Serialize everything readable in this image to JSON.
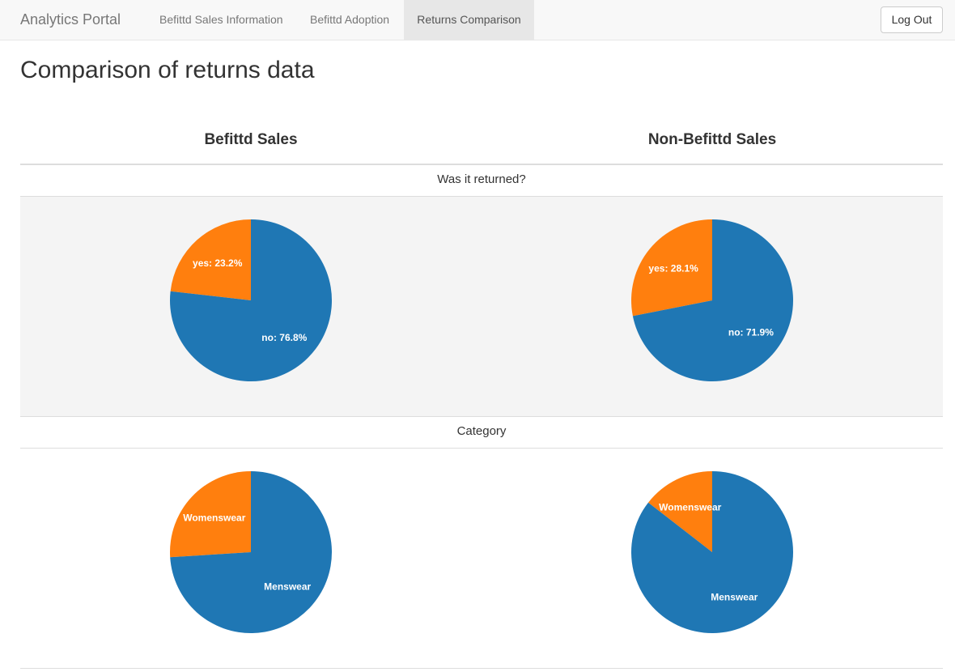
{
  "navbar": {
    "brand": "Analytics Portal",
    "items": [
      {
        "label": "Befittd Sales Information",
        "active": false
      },
      {
        "label": "Befittd Adoption",
        "active": false
      },
      {
        "label": "Returns Comparison",
        "active": true
      }
    ],
    "logout_label": "Log Out"
  },
  "page": {
    "title": "Comparison of returns data",
    "columns": [
      "Befittd Sales",
      "Non-Befittd Sales"
    ]
  },
  "sections": [
    {
      "label": "Was it returned?"
    },
    {
      "label": "Category"
    }
  ],
  "colors": {
    "blue": "#1f77b4",
    "orange": "#ff7f0e"
  },
  "chart_data": [
    {
      "type": "pie",
      "group": "Befittd Sales",
      "section": "Was it returned?",
      "slices": [
        {
          "name": "yes",
          "label": "yes: 23.2%",
          "value": 23.2,
          "color": "#ff7f0e"
        },
        {
          "name": "no",
          "label": "no: 76.8%",
          "value": 76.8,
          "color": "#1f77b4"
        }
      ]
    },
    {
      "type": "pie",
      "group": "Non-Befittd Sales",
      "section": "Was it returned?",
      "slices": [
        {
          "name": "yes",
          "label": "yes: 28.1%",
          "value": 28.1,
          "color": "#ff7f0e"
        },
        {
          "name": "no",
          "label": "no: 71.9%",
          "value": 71.9,
          "color": "#1f77b4"
        }
      ]
    },
    {
      "type": "pie",
      "group": "Befittd Sales",
      "section": "Category",
      "slices": [
        {
          "name": "Womenswear",
          "label": "Womenswear",
          "value": 26,
          "color": "#ff7f0e"
        },
        {
          "name": "Menswear",
          "label": "Menswear",
          "value": 74,
          "color": "#1f77b4"
        }
      ]
    },
    {
      "type": "pie",
      "group": "Non-Befittd Sales",
      "section": "Category",
      "slices": [
        {
          "name": "Womenswear",
          "label": "Womenswear",
          "value": 14.5,
          "color": "#ff7f0e"
        },
        {
          "name": "Menswear",
          "label": "Menswear",
          "value": 85.5,
          "color": "#1f77b4"
        }
      ]
    }
  ]
}
